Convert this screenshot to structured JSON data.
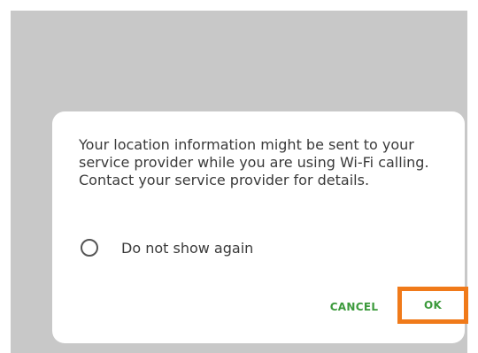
{
  "dialog": {
    "message": "Your location information might be sent to your service provider while you are using Wi-Fi calling. Contact your service provider for details.",
    "checkbox_label": "Do not show again",
    "cancel_label": "CANCEL",
    "ok_label": "OK"
  },
  "colors": {
    "backdrop": "#c8c8c8",
    "button_text": "#3c9a3c",
    "highlight_box": "#f07a1a"
  }
}
